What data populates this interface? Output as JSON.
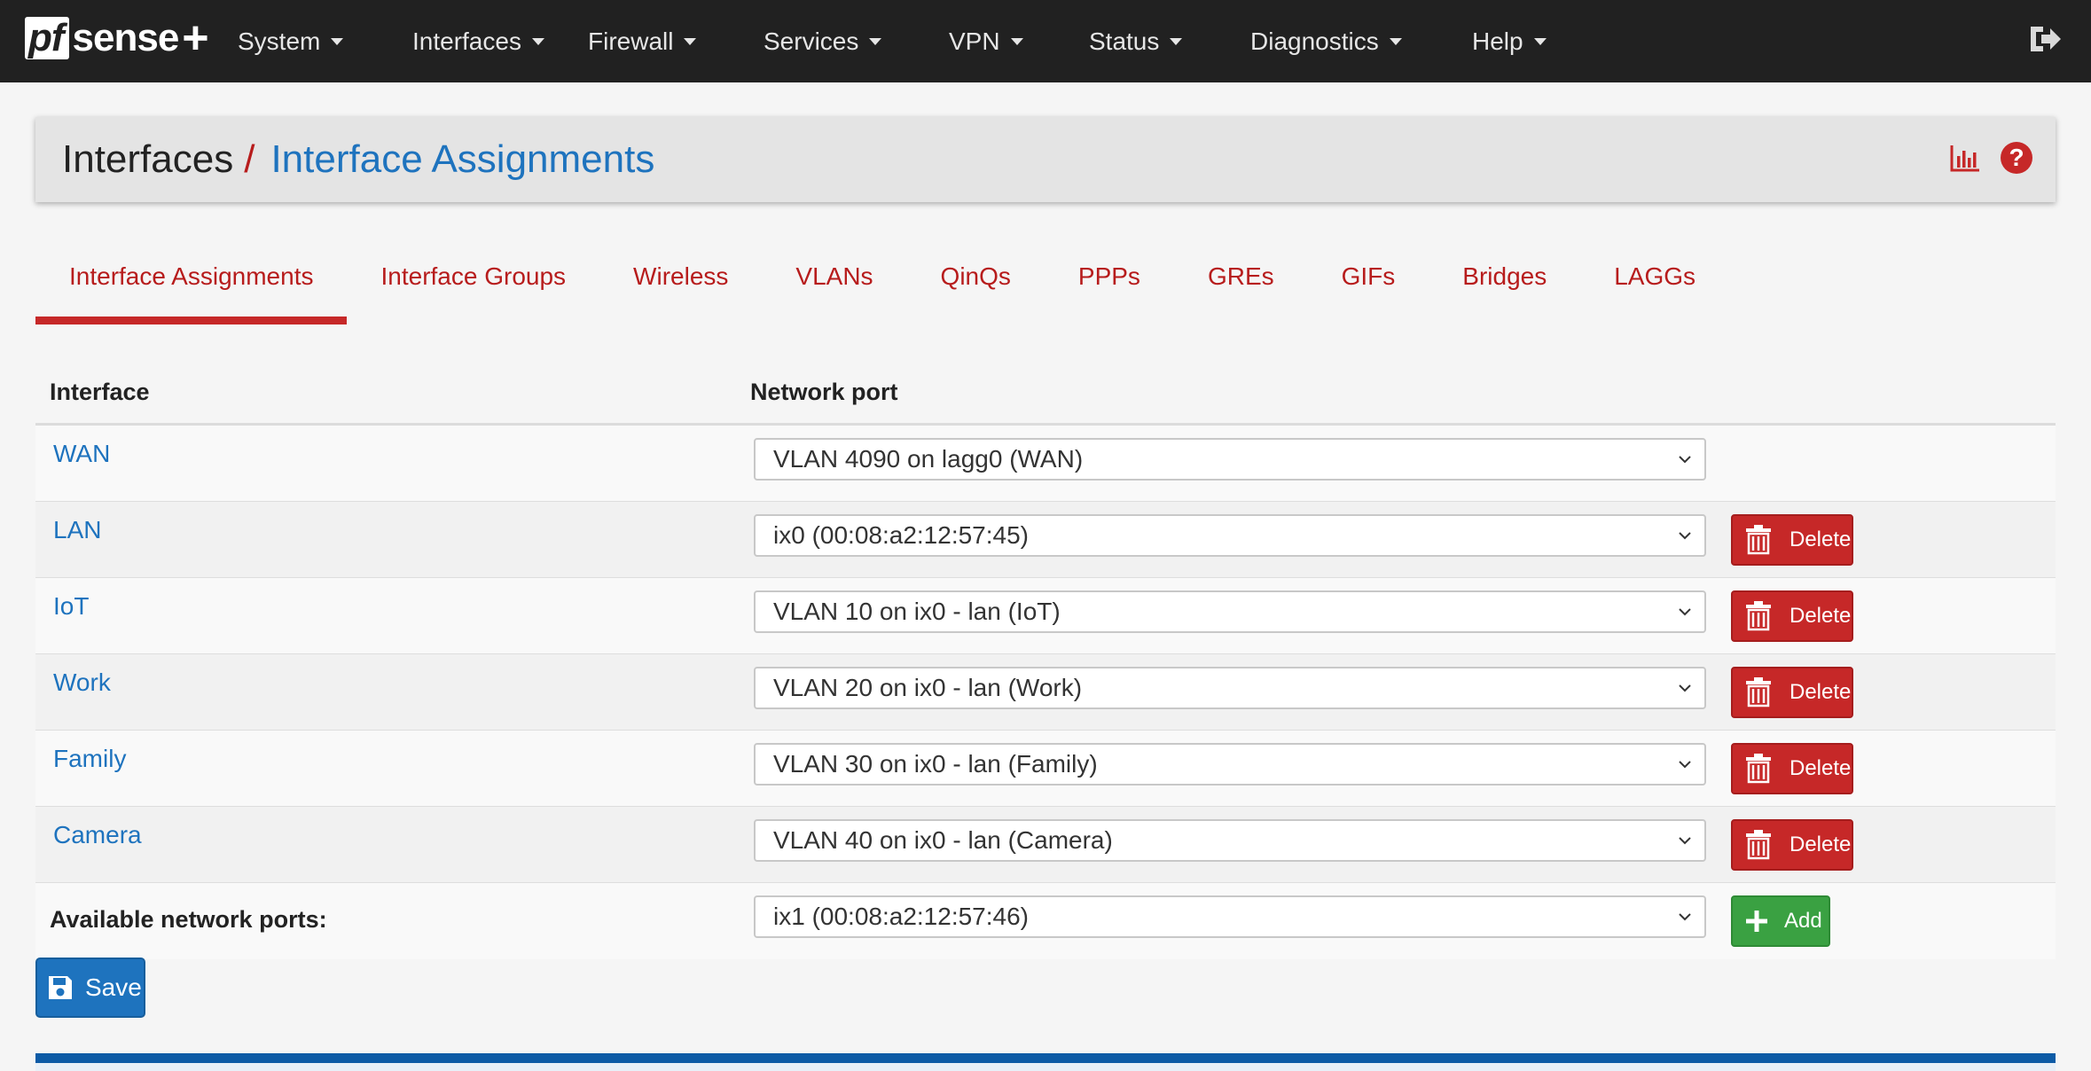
{
  "brand": {
    "pf": "pf",
    "sense": "sense",
    "plus": "+"
  },
  "nav": {
    "items": [
      "System",
      "Interfaces",
      "Firewall",
      "Services",
      "VPN",
      "Status",
      "Diagnostics",
      "Help"
    ]
  },
  "breadcrumb": {
    "root": "Interfaces",
    "separator": "/",
    "current": "Interface Assignments"
  },
  "tabs": [
    {
      "label": "Interface Assignments",
      "active": true
    },
    {
      "label": "Interface Groups"
    },
    {
      "label": "Wireless"
    },
    {
      "label": "VLANs"
    },
    {
      "label": "QinQs"
    },
    {
      "label": "PPPs"
    },
    {
      "label": "GREs"
    },
    {
      "label": "GIFs"
    },
    {
      "label": "Bridges"
    },
    {
      "label": "LAGGs"
    }
  ],
  "table": {
    "headers": {
      "interface": "Interface",
      "network_port": "Network port"
    },
    "rows": [
      {
        "interface": "WAN",
        "port": "VLAN 4090 on lagg0 (WAN)",
        "deletable": false
      },
      {
        "interface": "LAN",
        "port": "ix0 (00:08:a2:12:57:45)",
        "deletable": true
      },
      {
        "interface": "IoT",
        "port": "VLAN 10 on ix0 - lan (IoT)",
        "deletable": true
      },
      {
        "interface": "Work",
        "port": "VLAN 20 on ix0 - lan (Work)",
        "deletable": true
      },
      {
        "interface": "Family",
        "port": "VLAN 30 on ix0 - lan (Family)",
        "deletable": true
      },
      {
        "interface": "Camera",
        "port": "VLAN 40 on ix0 - lan (Camera)",
        "deletable": true
      }
    ],
    "available": {
      "label": "Available network ports:",
      "port": "ix1 (00:08:a2:12:57:46)"
    }
  },
  "buttons": {
    "delete": "Delete",
    "add": "Add",
    "save": "Save"
  },
  "icons": {
    "nav_caret": "caret-down-icon",
    "logout": "sign-out-icon",
    "chart": "bar-chart-icon",
    "help": "question-circle-icon",
    "select": "chevron-down-icon",
    "delete": "trash-icon",
    "add": "plus-icon",
    "save": "floppy-disk-icon"
  },
  "colors": {
    "navbar": "#212121",
    "accent_red": "#c62828",
    "link_blue": "#1e73be",
    "add_green": "#3aa142"
  }
}
